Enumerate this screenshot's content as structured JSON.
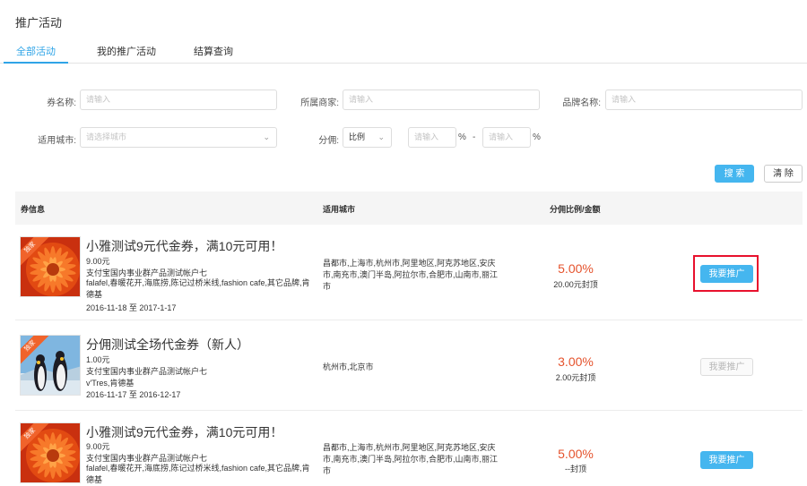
{
  "page_title": "推广活动",
  "tabs": [
    {
      "label": "全部活动",
      "active": true
    },
    {
      "label": "我的推广活动",
      "active": false
    },
    {
      "label": "结算查询",
      "active": false
    }
  ],
  "filters": {
    "coupon_name": {
      "label": "券名称:",
      "placeholder": "请输入"
    },
    "merchant": {
      "label": "所属商家:",
      "placeholder": "请输入"
    },
    "brand": {
      "label": "品牌名称:",
      "placeholder": "请输入"
    },
    "city": {
      "label": "适用城市:",
      "placeholder": "请选择城市"
    },
    "commission": {
      "label": "分佣:",
      "type_value": "比例",
      "min_placeholder": "请输入",
      "max_placeholder": "请输入",
      "unit": "%",
      "separator": "-"
    }
  },
  "buttons": {
    "search": "搜 索",
    "clear": "清 除"
  },
  "table": {
    "headers": {
      "coupon": "券信息",
      "cities": "适用城市",
      "commission": "分佣比例/金额"
    },
    "rows": [
      {
        "badge": "独家",
        "title": "小雅测试9元代金券，满10元可用！",
        "price": "9.00元",
        "account": "支付宝国内事业群产品测试帐户七",
        "brands": "falafel,春暖花开,海底捞,陈记过桥米线,fashion cafe,其它品牌,肯德基",
        "dates": "2016-11-18 至 2017-1-17",
        "cities": "昌都市,上海市,杭州市,阿里地区,阿克苏地区,安庆市,南充市,澳门半岛,阿拉尔市,合肥市,山南市,丽江市",
        "ratio": "5.00%",
        "cap": "20.00元封顶",
        "action": "我要推广",
        "action_enabled": true,
        "image": "orange-flower"
      },
      {
        "badge": "独家",
        "title": "分佣测试全场代金券（新人）",
        "price": "1.00元",
        "account": "支付宝国内事业群产品测试帐户七",
        "brands": "v'Tres,肯德基",
        "dates": "2016-11-17 至 2016-12-17",
        "cities": "杭州市,北京市",
        "ratio": "3.00%",
        "cap": "2.00元封顶",
        "action": "我要推广",
        "action_enabled": false,
        "image": "penguins"
      },
      {
        "badge": "独家",
        "title": "小雅测试9元代金券，满10元可用！",
        "price": "9.00元",
        "account": "支付宝国内事业群产品测试帐户七",
        "brands": "falafel,春暖花开,海底捞,陈记过桥米线,fashion cafe,其它品牌,肯德基",
        "dates": "",
        "cities": "昌都市,上海市,杭州市,阿里地区,阿克苏地区,安庆市,南充市,澳门半岛,阿拉尔市,合肥市,山南市,丽江市",
        "ratio": "5.00%",
        "cap": "--封顶",
        "action": "我要推广",
        "action_enabled": true,
        "image": "orange-flower"
      }
    ]
  },
  "colors": {
    "accent": "#2fa4e7",
    "primary_button": "#45b6ef",
    "ratio": "#e5532d",
    "ribbon": "#f0632b",
    "highlight": "#e8112d"
  }
}
